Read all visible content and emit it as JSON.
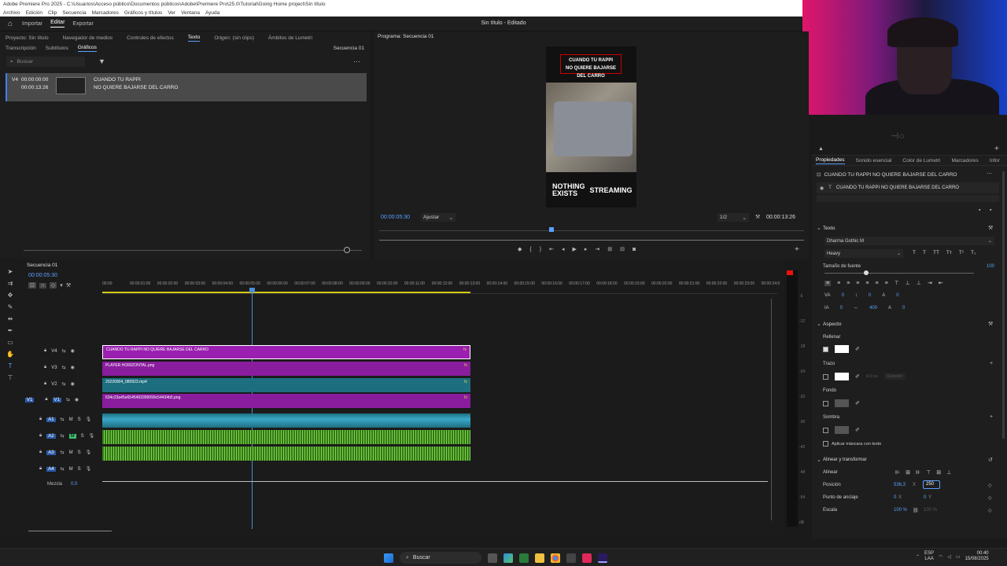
{
  "titlebar": {
    "text": "Adobe Premiere Pro 2025 - C:\\Usuarios\\Acceso público\\Documentos públicos\\Adobe\\Premiere Pro\\25.0\\Tutorial\\Going Home project\\Sin título"
  },
  "menu": [
    "Archivo",
    "Edición",
    "Clip",
    "Secuencia",
    "Marcadores",
    "Gráficos y títulos",
    "Ver",
    "Ventana",
    "Ayuda"
  ],
  "workspaces": [
    {
      "label": "Importar"
    },
    {
      "label": "Editar"
    },
    {
      "label": "Exportar"
    }
  ],
  "doc_title": "Sin título - Editado",
  "left_panel": {
    "tabs": [
      "Proyecto: Sin título",
      "Navegador de medios",
      "Controles de efectos",
      "Texto",
      "Origen: (sin clips)",
      "Ámbitos de Lumetri"
    ],
    "subtabs": [
      "Transcripción",
      "Subtítulos",
      "Gráficos"
    ],
    "sequence_label": "Secuencia 01",
    "search_placeholder": "Buscar",
    "clip": {
      "track": "V4",
      "tc_in": "00:00:00:00",
      "tc_out": "00:00:13:26",
      "title": "CUANDO TU RAPPI",
      "subtitle": "NO QUIERE BAJARSE DEL CARRO"
    }
  },
  "program": {
    "title": "Programa: Secuencia 01",
    "timecode": "00:00:05:30",
    "fit": "Ajustar",
    "quality": "1/2",
    "duration": "00:00:13:26",
    "caption_line1": "CUANDO TU RAPPI",
    "caption_line2": "NO QUIERE BAJARSE DEL CARRO",
    "logo_left": "NOTHING EXISTS",
    "logo_right": "STREAMING"
  },
  "timeline": {
    "sequence_tab": "Secuencia 01",
    "timecode": "00:00:05:30",
    "ruler": [
      "00:00",
      "00:00:01:00",
      "00:00:02:00",
      "00:00:03:00",
      "00:00:04:00",
      "00:00:05:00",
      "00:00:06:00",
      "00:00:07:00",
      "00:00:08:00",
      "00:00:09:00",
      "00:00:10:00",
      "00:00:11:00",
      "00:00:12:00",
      "00:00:13:00",
      "00:00:14:00",
      "00:00:15:00",
      "00:00:16:00",
      "00:00:17:00",
      "00:00:18:00",
      "00:00:19:00",
      "00:00:20:00",
      "00:00:21:00",
      "00:00:22:00",
      "00:00:23:00",
      "00:00:24:0"
    ],
    "video_tracks": [
      {
        "name": "V4",
        "clip": "CUANDO TU RAPPI  NO QUIERE BAJARSE DEL CARRO",
        "color": "#9b1fb0"
      },
      {
        "name": "V3",
        "clip": "PLAYER HORIZONTAL.png",
        "color": "#8a1d9e"
      },
      {
        "name": "V2",
        "clip": "20220904_080923.mp4",
        "color": "#1d6f80"
      },
      {
        "name": "V1",
        "clip": "634c23a45e6545493399099c54434b5.png",
        "color": "#8a1d9e"
      }
    ],
    "audio_tracks": [
      "A1",
      "A2",
      "A3",
      "A4"
    ],
    "mix_label": "Mezcla",
    "mix_value": "0.0",
    "meter_labels": [
      "-6",
      "-12",
      "-18",
      "-24",
      "-30",
      "-36",
      "-42",
      "-48",
      "-54",
      "dB"
    ]
  },
  "props": {
    "tabs": [
      "Propiedades",
      "Sonido esencial",
      "Color de Lumetri",
      "Marcadores",
      "Infor"
    ],
    "layer_title": "CUANDO TU RAPPI  NO QUIERE BAJARSE DEL CARRO",
    "layer_item": "CUANDO TU RAPPI  NO QUIERE BAJARSE DEL CARRO",
    "text_section": "Texto",
    "font": "Dharma Gothic M",
    "weight": "Heavy",
    "font_size_label": "Tamaño de fuente",
    "font_size_value": "100",
    "tracking_value": "400",
    "aspect_section": "Aspecto",
    "fill_label": "Rellenar",
    "stroke_label": "Trazo",
    "stroke_width": "4.0 px",
    "stroke_mode": "Exterior",
    "background_label": "Fondo",
    "shadow_label": "Sombra",
    "mask_label": "Aplicar máscara con texto",
    "align_section": "Alinear y transformar",
    "align_label": "Alinear",
    "position_label": "Posición",
    "position_x": "536,3",
    "position_y": "250",
    "anchor_label": "Punto de anclaje",
    "anchor_x": "0",
    "anchor_y": "0",
    "scale_label": "Escala",
    "scale_value": "100 %",
    "scale_value2": "100 %"
  },
  "taskbar": {
    "search": "Buscar",
    "lang1": "ESP",
    "lang2": "LAA",
    "time": "00:40",
    "date": "15/08/2025"
  }
}
